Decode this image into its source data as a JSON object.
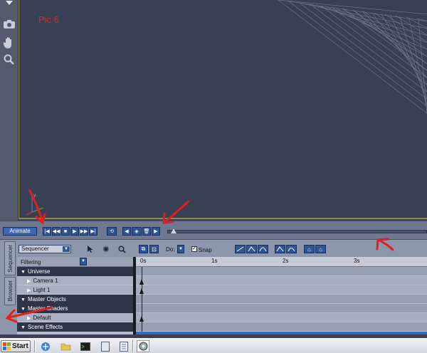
{
  "viewport": {
    "annotation": "Pic 6"
  },
  "animation_bar": {
    "animate_label": "Animate",
    "playback_glyphs": [
      "|◀",
      "◀◀",
      "■",
      "▶",
      "▶▶",
      "▶|"
    ],
    "loop_glyph": "⟲",
    "key_glyphs": [
      "◀",
      "◈",
      "🗑",
      "▶"
    ]
  },
  "sequencer": {
    "tabs": [
      "Sequencer",
      "Browser"
    ],
    "mode_select": "Sequencer",
    "do_label": "Do:",
    "snap_label": "Snap",
    "snap_checked": "✓",
    "filtering_label": "Filtering",
    "tree": [
      {
        "label": "Universe",
        "type": "header"
      },
      {
        "label": "Camera 1",
        "type": "child"
      },
      {
        "label": "Light 1",
        "type": "child"
      },
      {
        "label": "Master Objects",
        "type": "header"
      },
      {
        "label": "Master Shaders",
        "type": "header"
      },
      {
        "label": "Default",
        "type": "child"
      },
      {
        "label": "Scene Effects",
        "type": "header"
      }
    ],
    "ruler_labels": [
      "0s",
      "1s",
      "2s",
      "3s"
    ]
  },
  "taskbar": {
    "start_label": "Start",
    "colors": {
      "flag": [
        "#e84b1c",
        "#6fb52c",
        "#2b77d9",
        "#f2c30f"
      ]
    }
  },
  "colors": {
    "accent_blue": "#2e5596",
    "annotation_red": "#d8262b"
  }
}
